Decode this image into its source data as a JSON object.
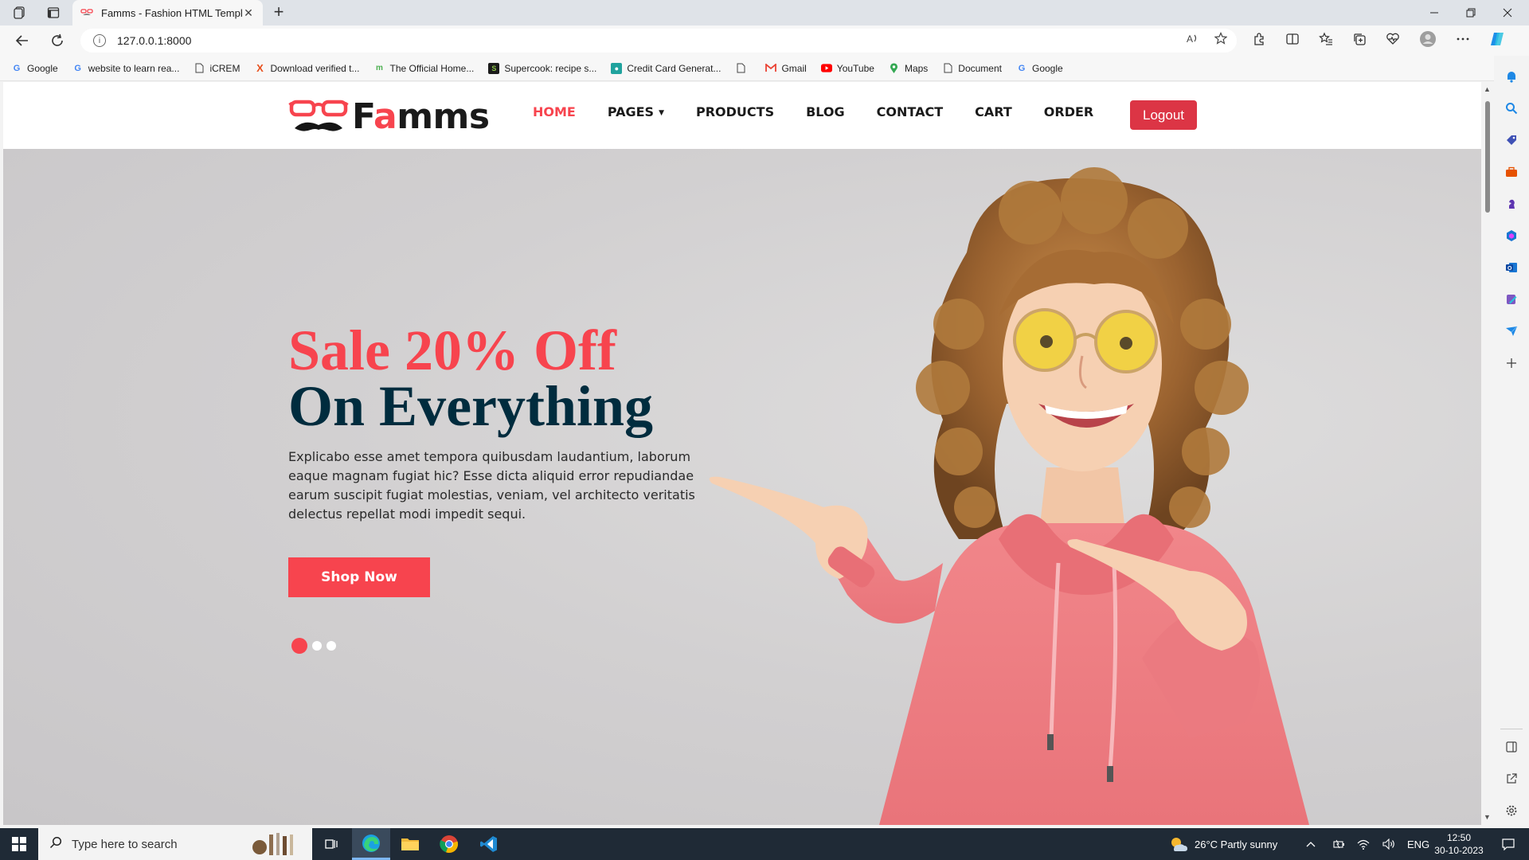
{
  "browser": {
    "tab_title": "Famms - Fashion HTML Template",
    "close_glyph": "✕",
    "new_tab_glyph": "+",
    "url": "127.0.0.1:8000",
    "bookmarks": [
      {
        "label": "Google",
        "icon": "google-icon",
        "color": "#4285f4"
      },
      {
        "label": "website to learn rea...",
        "icon": "google-icon",
        "color": "#4285f4"
      },
      {
        "label": "iCREM",
        "icon": "page-icon",
        "color": "#555555"
      },
      {
        "label": "Download verified t...",
        "icon": "x-icon",
        "color": "#e8501d"
      },
      {
        "label": "The Official Home...",
        "icon": "m-icon",
        "color": "#4caf50"
      },
      {
        "label": "Supercook: recipe s...",
        "icon": "supercook-icon",
        "color": "#2e7d32"
      },
      {
        "label": "Credit Card Generat...",
        "icon": "person-icon",
        "color": "#20a39e"
      },
      {
        "label": "",
        "icon": "page-icon",
        "color": "#555555"
      },
      {
        "label": "Gmail",
        "icon": "gmail-icon",
        "color": "#ea4335"
      },
      {
        "label": "YouTube",
        "icon": "youtube-icon",
        "color": "#ff0000"
      },
      {
        "label": "Maps",
        "icon": "maps-icon",
        "color": "#34a853"
      },
      {
        "label": "Document",
        "icon": "page-icon",
        "color": "#555555"
      },
      {
        "label": "Google",
        "icon": "google-icon",
        "color": "#4285f4"
      }
    ]
  },
  "site": {
    "logo_prefix": "F",
    "logo_accent": "a",
    "logo_suffix": "mms",
    "nav": [
      {
        "label": "HOME",
        "active": true
      },
      {
        "label": "PAGES",
        "active": false,
        "dropdown": true
      },
      {
        "label": "PRODUCTS",
        "active": false
      },
      {
        "label": "BLOG",
        "active": false
      },
      {
        "label": "CONTACT",
        "active": false
      },
      {
        "label": "CART",
        "active": false
      },
      {
        "label": "ORDER",
        "active": false
      }
    ],
    "dropdown_caret": "▼",
    "logout_label": "Logout",
    "accent_color": "#f7444e",
    "logout_color": "#dc3545"
  },
  "hero": {
    "headline_1": "Sale 20% Off",
    "headline_2": "On Everything",
    "body": "Explicabo esse amet tempora quibusdam laudantium, laborum eaque magnam fugiat hic? Esse dicta aliquid error repudiandae earum suscipit fugiat molestias, veniam, vel architecto veritatis delectus repellat modi impedit sequi.",
    "cta_label": "Shop Now",
    "slides_total": 3,
    "active_slide": 1
  },
  "taskbar": {
    "search_placeholder": "Type here to search",
    "weather": "26°C  Partly sunny",
    "lang": "ENG",
    "time": "12:50",
    "date": "30-10-2023"
  }
}
